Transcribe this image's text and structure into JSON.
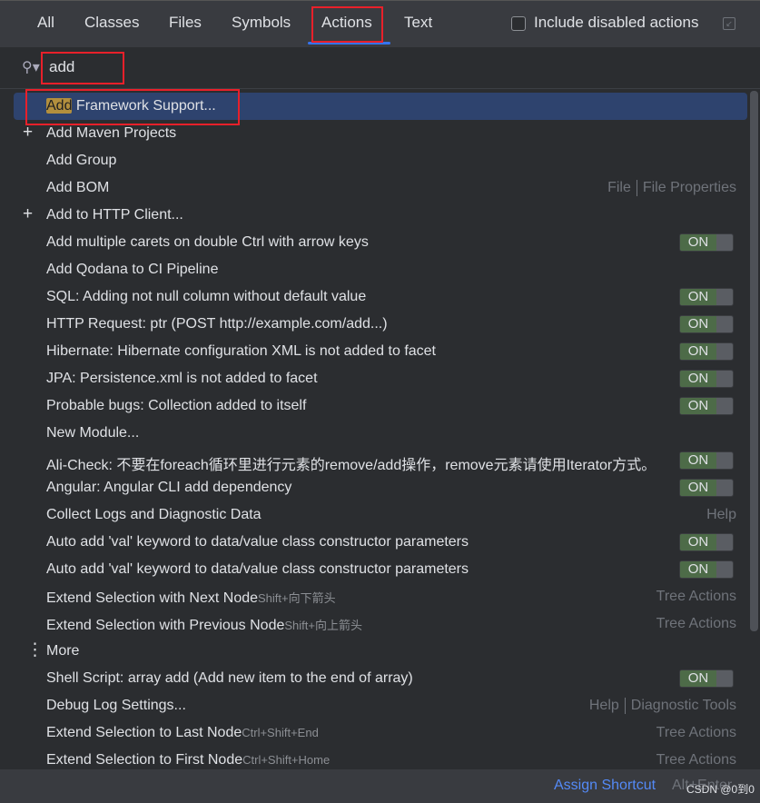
{
  "tabs": [
    {
      "label": "All"
    },
    {
      "label": "Classes"
    },
    {
      "label": "Files"
    },
    {
      "label": "Symbols"
    },
    {
      "label": "Actions",
      "active": true
    },
    {
      "label": "Text"
    }
  ],
  "include_disabled": {
    "label": "Include disabled actions",
    "checked": false
  },
  "search": {
    "value": "add"
  },
  "items": [
    {
      "pre": "Add",
      "label": " Framework Support...",
      "selected": true
    },
    {
      "icon": "plus",
      "label": "Add Maven Projects"
    },
    {
      "label": "Add Group"
    },
    {
      "label": "Add BOM",
      "right": [
        "File",
        "File Properties"
      ]
    },
    {
      "icon": "plus",
      "label": "Add to HTTP Client..."
    },
    {
      "label": "Add multiple carets on double Ctrl with arrow keys",
      "toggle": "ON"
    },
    {
      "label": "Add Qodana to CI Pipeline"
    },
    {
      "label": "SQL: Adding not null column without default value",
      "toggle": "ON"
    },
    {
      "label": "HTTP Request: ptr (POST http://example.com/add...)",
      "toggle": "ON"
    },
    {
      "label": "Hibernate: Hibernate configuration XML is not added to facet",
      "toggle": "ON"
    },
    {
      "label": "JPA: Persistence.xml is not added to facet",
      "toggle": "ON"
    },
    {
      "label": "Probable bugs: Collection added to itself",
      "toggle": "ON"
    },
    {
      "label": "New Module..."
    },
    {
      "label": "Ali-Check: 不要在foreach循环里进行元素的remove/add操作，remove元素请使用Iterator方式。",
      "toggle": "ON"
    },
    {
      "label": "Angular: Angular CLI add dependency",
      "toggle": "ON"
    },
    {
      "label": "Collect Logs and Diagnostic Data",
      "right": [
        "Help"
      ]
    },
    {
      "label": "Auto add 'val' keyword to data/value class constructor parameters",
      "toggle": "ON"
    },
    {
      "label": "Auto add 'val' keyword to data/value class constructor parameters",
      "toggle": "ON"
    },
    {
      "label": "Extend Selection with Next Node",
      "shortcut": "Shift+向下箭头",
      "right": [
        "Tree Actions"
      ]
    },
    {
      "label": "Extend Selection with Previous Node",
      "shortcut": "Shift+向上箭头",
      "right": [
        "Tree Actions"
      ]
    },
    {
      "icon": "more",
      "label": "More"
    },
    {
      "label": "Shell Script: array add (Add new item to the end of array)",
      "toggle": "ON"
    },
    {
      "label": "Debug Log Settings...",
      "right": [
        "Help",
        "Diagnostic Tools"
      ]
    },
    {
      "label": "Extend Selection to Last Node",
      "shortcut": "Ctrl+Shift+End",
      "right": [
        "Tree Actions"
      ]
    },
    {
      "label": "Extend Selection to First Node",
      "shortcut": "Ctrl+Shift+Home",
      "right": [
        "Tree Actions"
      ]
    }
  ],
  "footer": {
    "assign": "Assign Shortcut",
    "key": "Alt+Enter",
    "watermark": "CSDN @0到0"
  },
  "colors": {
    "accent": "#3574f0",
    "selection": "#2e436e",
    "toggle_on": "#4d6b48",
    "annotation": "#e8202a"
  }
}
